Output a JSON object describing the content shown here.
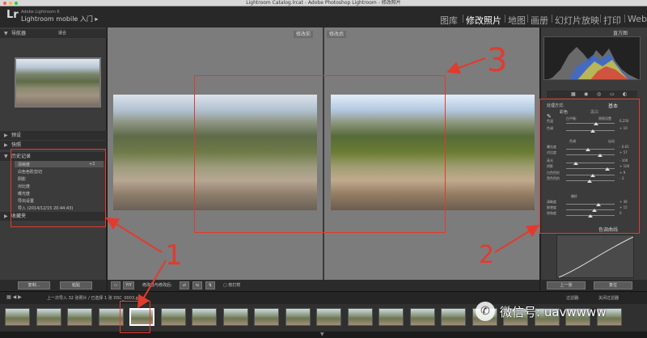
{
  "window": {
    "title": "Lightroom Catalog.lrcat - Adobe Photoshop Lightroom - 修改照片"
  },
  "app": {
    "logo": "Lr",
    "subtitle": "Adobe Lightroom 6",
    "identity_plate": "Lightroom mobile 入门"
  },
  "modules": [
    {
      "label": "图库",
      "active": false
    },
    {
      "label": "修改照片",
      "active": true
    },
    {
      "label": "地图",
      "active": false
    },
    {
      "label": "画册",
      "active": false
    },
    {
      "label": "幻灯片放映",
      "active": false
    },
    {
      "label": "打印",
      "active": false
    },
    {
      "label": "Web",
      "active": false
    }
  ],
  "left_panel": {
    "navigator": "导航器",
    "navigator_zoom": "适合",
    "presets": "预设",
    "snapshots": "快照",
    "history": "历史记录",
    "history_items": [
      "清晰度",
      "白色色阶剪切",
      "阴影",
      "对比度",
      "曝光度",
      "导出设置",
      "导入 (2014/12/15 20:44:43)"
    ],
    "history_value": "+2",
    "collections": "收藏夹",
    "copy_button": "复制...",
    "paste_button": "粘贴"
  },
  "center": {
    "before_label": "修改前",
    "after_label": "修改后",
    "toolbar_view": "YIY",
    "toolbar_text": "修改前与修改后:",
    "soft_proof": "软打样"
  },
  "right_panel": {
    "histogram": "直方图",
    "basic": "基本",
    "treatment_label": "处理方式:",
    "treatment_color": "彩色",
    "treatment_bw": "黑白",
    "profile_label": "配置文件:",
    "wb_label": "白平衡:",
    "wb_value": "原照设置",
    "tone_label": "色调",
    "auto_label": "自动",
    "presence_label": "偏好",
    "tone_curve": "色调曲线",
    "sliders": [
      {
        "label": "色温",
        "value": "6,250"
      },
      {
        "label": "色调",
        "value": "+ 10"
      },
      {
        "label": "曝光度",
        "value": "- 0.65"
      },
      {
        "label": "对比度",
        "value": "+ 57"
      },
      {
        "label": "高光",
        "value": "- 100"
      },
      {
        "label": "阴影",
        "value": "+ 100"
      },
      {
        "label": "白色色阶",
        "value": "+ 9"
      },
      {
        "label": "黑色色阶",
        "value": "- 3"
      },
      {
        "label": "清晰度",
        "value": "+ 36"
      },
      {
        "label": "鲜艳度",
        "value": "+ 15"
      },
      {
        "label": "饱和度",
        "value": "0"
      }
    ],
    "prev_button": "上一张",
    "reset_button": "复位"
  },
  "filmstrip": {
    "info": "上一次导入  32 张照片 / 已选择 1 张  DSC_0003.jpg",
    "filter_label": "过滤器:",
    "filter_value": "关闭过滤器",
    "thumb_count": 20
  },
  "annotations": {
    "num1": "1",
    "num2": "2",
    "num3": "3"
  },
  "watermark": {
    "text": "微信号: uavwwww"
  },
  "colors": {
    "annotation_red": "#e23b2e",
    "panel_bg": "#3b3b3b",
    "center_bg": "#7c7c7c"
  }
}
